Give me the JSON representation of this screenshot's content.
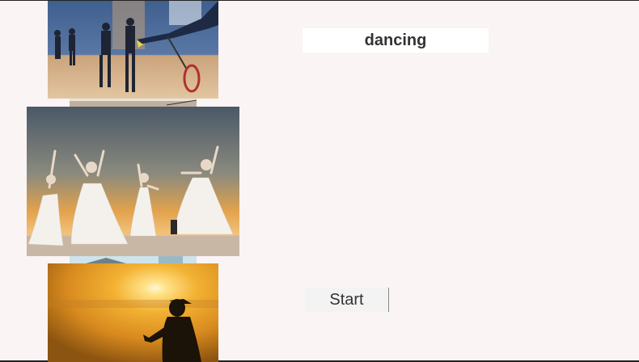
{
  "prompt": {
    "word": "dancing"
  },
  "controls": {
    "start_label": "Start"
  },
  "images": [
    {
      "subject": "badminton-players"
    },
    {
      "subject": "ballet-dancers-sunset"
    },
    {
      "subject": "runner-silhouette-sunrise"
    }
  ]
}
